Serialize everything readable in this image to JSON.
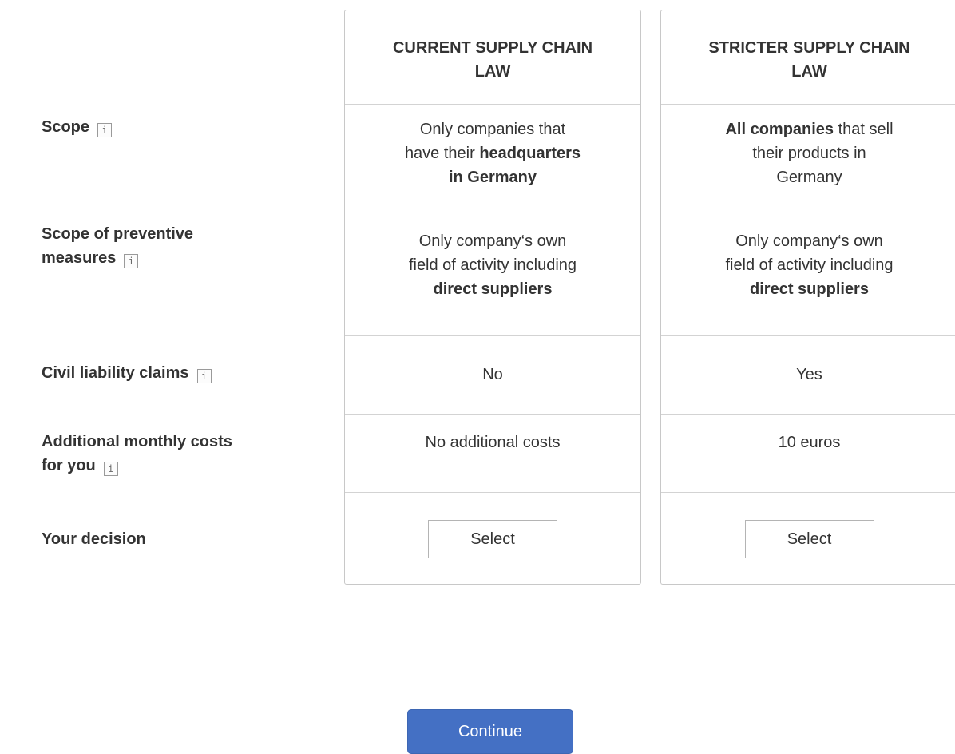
{
  "rows": {
    "scope": "Scope",
    "preventive_line1": "Scope of preventive",
    "preventive_line2": "measures",
    "liability": "Civil liability claims",
    "costs_line1": "Additional monthly costs",
    "costs_line2": "for you",
    "decision": "Your decision"
  },
  "info_glyph": "i",
  "options": [
    {
      "header_line1": "CURRENT SUPPLY CHAIN",
      "header_line2": "LAW",
      "scope": {
        "line1": "Only companies that",
        "line2_pre": "have their ",
        "line2_bold": "headquarters",
        "line3_bold": "in Germany"
      },
      "preventive": {
        "line1": "Only company‘s own",
        "line2": "field of activity including",
        "line3_bold": "direct suppliers"
      },
      "liability": "No",
      "costs": "No additional costs",
      "select_label": "Select"
    },
    {
      "header_line1": "STRICTER SUPPLY CHAIN",
      "header_line2": "LAW",
      "scope": {
        "line1_bold": "All companies",
        "line1_rest": " that sell",
        "line2": "their products in",
        "line3": "Germany"
      },
      "preventive": {
        "line1": "Only company‘s own",
        "line2": "field of activity including",
        "line3_bold": "direct suppliers"
      },
      "liability": "Yes",
      "costs": "10 euros",
      "select_label": "Select"
    }
  ],
  "continue_label": "Continue",
  "colors": {
    "accent": "#4470c4",
    "border": "#c8c8c8",
    "text": "#333333"
  }
}
